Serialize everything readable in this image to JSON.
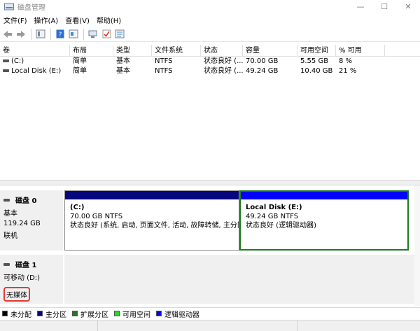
{
  "window": {
    "title": "磁盘管理"
  },
  "menu": [
    "文件(F)",
    "操作(A)",
    "查看(V)",
    "帮助(H)"
  ],
  "toolbar": {
    "icons": [
      "back-icon",
      "forward-icon",
      "up-icon",
      "list-view-icon",
      "help-icon",
      "properties-icon",
      "connect-icon",
      "check-icon",
      "settings-icon"
    ]
  },
  "volume_table": {
    "headers": [
      "卷",
      "布局",
      "类型",
      "文件系统",
      "状态",
      "容量",
      "可用空间",
      "% 可用"
    ],
    "rows": [
      [
        "(C:)",
        "简单",
        "基本",
        "NTFS",
        "状态良好 (...",
        "70.00 GB",
        "5.55 GB",
        "8 %"
      ],
      [
        "Local Disk (E:)",
        "简单",
        "基本",
        "NTFS",
        "状态良好 (...",
        "49.24 GB",
        "10.40 GB",
        "21 %"
      ]
    ]
  },
  "disks": [
    {
      "name": "磁盘 0",
      "type": "基本",
      "size": "119.24 GB",
      "state": "联机",
      "partitions": [
        {
          "name": "(C:)",
          "size_fs": "70.00 GB NTFS",
          "status": "状态良好 (系统, 启动, 页面文件, 活动, 故障转储, 主分区"
        },
        {
          "name": "Local Disk  (E:)",
          "size_fs": "49.24 GB NTFS",
          "status": "状态良好 (逻辑驱动器)"
        }
      ]
    },
    {
      "name": "磁盘 1",
      "type": "可移动 (D:)",
      "state": "无媒体"
    }
  ],
  "legend": [
    {
      "label": "未分配",
      "color": "#000000"
    },
    {
      "label": "主分区",
      "color": "#06067d"
    },
    {
      "label": "扩展分区",
      "color": "#1e7a1e"
    },
    {
      "label": "可用空间",
      "color": "#22dd22"
    },
    {
      "label": "逻辑驱动器",
      "color": "#0000ff"
    }
  ]
}
